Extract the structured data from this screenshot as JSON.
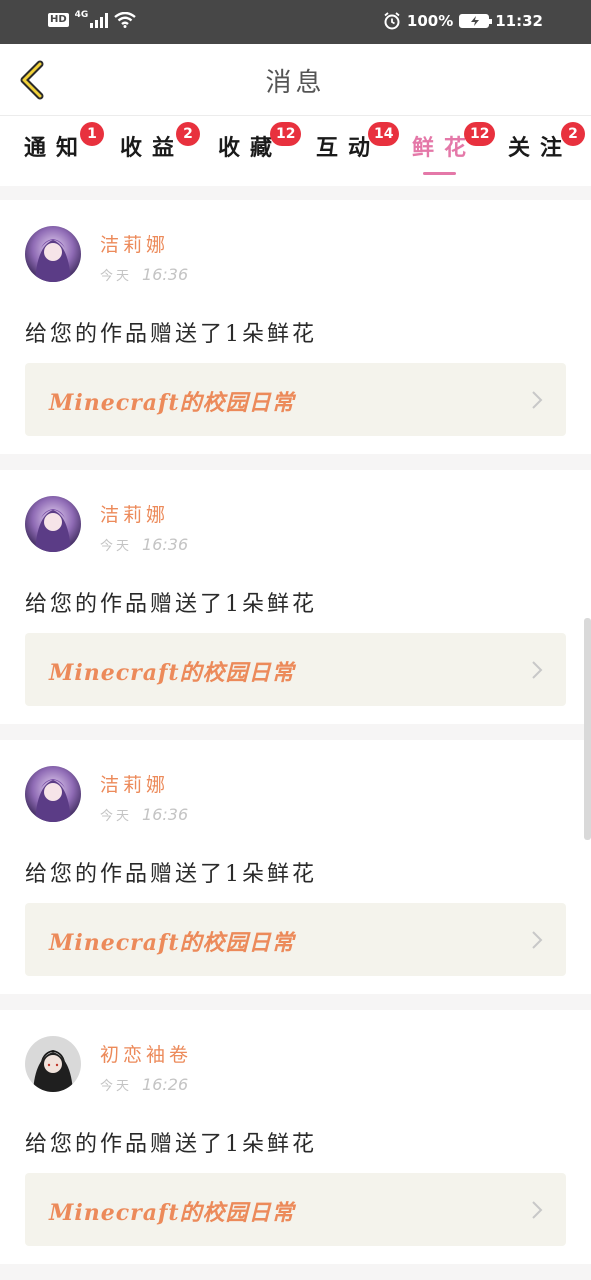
{
  "status_bar": {
    "hd": "HD",
    "network": "4G",
    "battery_percent": "100%",
    "time": "11:32",
    "icons": [
      "wifi-icon",
      "signal-icon",
      "alarm-icon",
      "battery-icon"
    ]
  },
  "nav": {
    "title": "消息",
    "back_icon": "chevron-left-icon"
  },
  "tabs": [
    {
      "label": "通知",
      "badge": "1"
    },
    {
      "label": "收益",
      "badge": "2"
    },
    {
      "label": "收藏",
      "badge": "12"
    },
    {
      "label": "互动",
      "badge": "14"
    },
    {
      "label": "鲜花",
      "badge": "12",
      "active": true
    },
    {
      "label": "关注",
      "badge": "2"
    }
  ],
  "colors": {
    "accent": "#e478a8",
    "badge": "#e8313e",
    "orange": "#ec8a5a"
  },
  "notifications": [
    {
      "user": "洁莉娜",
      "day": "今天",
      "time": "16:36",
      "message": "给您的作品赠送了1朵鲜花",
      "work": "Minecraft的校园日常",
      "avatar": "anime-avatar-purple"
    },
    {
      "user": "洁莉娜",
      "day": "今天",
      "time": "16:36",
      "message": "给您的作品赠送了1朵鲜花",
      "work": "Minecraft的校园日常",
      "avatar": "anime-avatar-purple"
    },
    {
      "user": "洁莉娜",
      "day": "今天",
      "time": "16:36",
      "message": "给您的作品赠送了1朵鲜花",
      "work": "Minecraft的校园日常",
      "avatar": "anime-avatar-purple"
    },
    {
      "user": "初恋袖卷",
      "day": "今天",
      "time": "16:26",
      "message": "给您的作品赠送了1朵鲜花",
      "work": "Minecraft的校园日常",
      "avatar": "anime-avatar-dark"
    }
  ]
}
